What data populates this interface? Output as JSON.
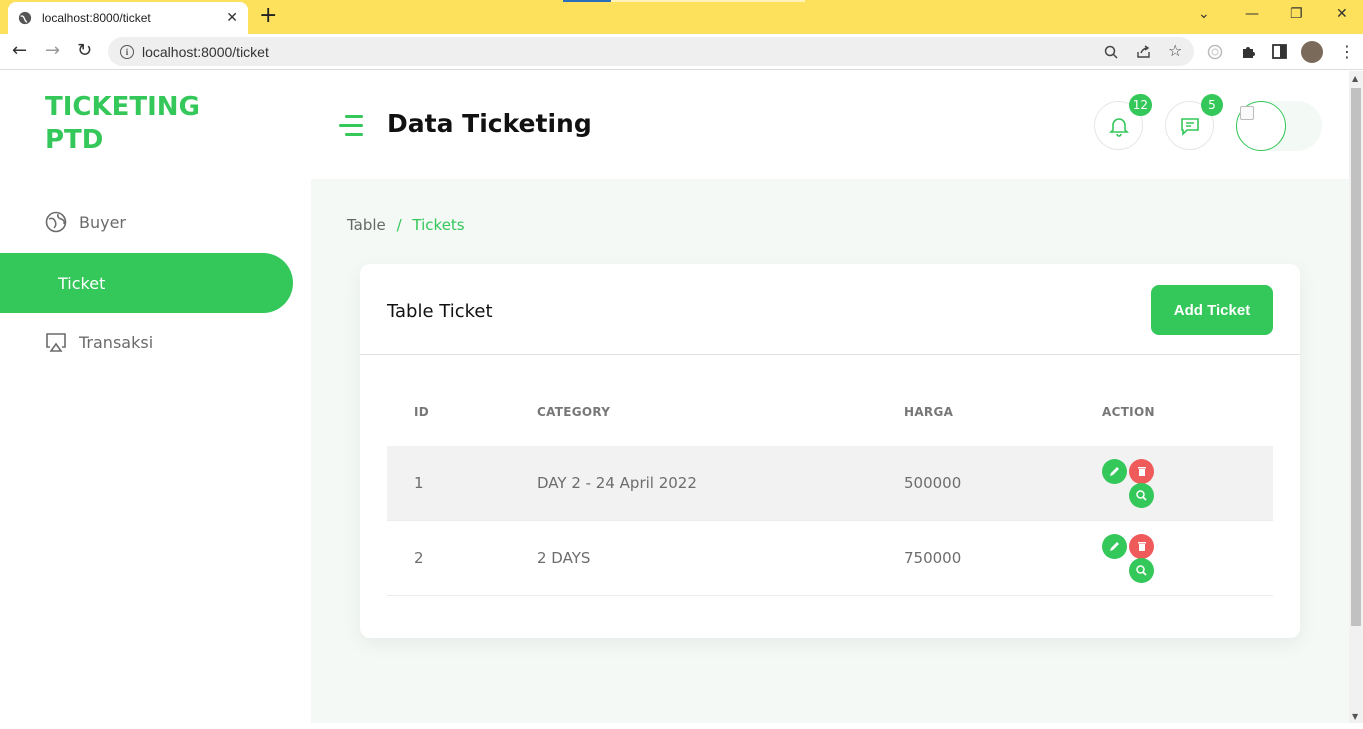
{
  "browser": {
    "tab_title": "localhost:8000/ticket",
    "url": "localhost:8000/ticket",
    "icons": [
      "globe-icon",
      "close-icon",
      "plus-icon",
      "back-icon",
      "forward-icon",
      "reload-icon",
      "info-icon",
      "zoom-icon",
      "share-icon",
      "star-icon",
      "extension-icon",
      "puzzle-icon",
      "sidepanel-icon",
      "profile-icon",
      "menu-icon"
    ]
  },
  "app": {
    "logo": "TICKETING PTD",
    "page_title": "Data Ticketing",
    "accent_color": "#34c759",
    "notifications_count": "12",
    "messages_count": "5"
  },
  "sidebar": {
    "items": [
      {
        "label": "Buyer",
        "icon": "globe-icon",
        "active": false
      },
      {
        "label": "Ticket",
        "icon": "",
        "active": true
      },
      {
        "label": "Transaksi",
        "icon": "airplay-icon",
        "active": false
      }
    ]
  },
  "breadcrumb": {
    "parent": "Table",
    "separator": "/",
    "current": "Tickets"
  },
  "card": {
    "title": "Table Ticket",
    "add_button": "Add Ticket"
  },
  "table": {
    "headers": [
      "ID",
      "CATEGORY",
      "HARGA",
      "ACTION"
    ],
    "rows": [
      {
        "id": "1",
        "category": "DAY 2 - 24 April 2022",
        "harga": "500000"
      },
      {
        "id": "2",
        "category": "2 DAYS",
        "harga": "750000"
      }
    ]
  }
}
